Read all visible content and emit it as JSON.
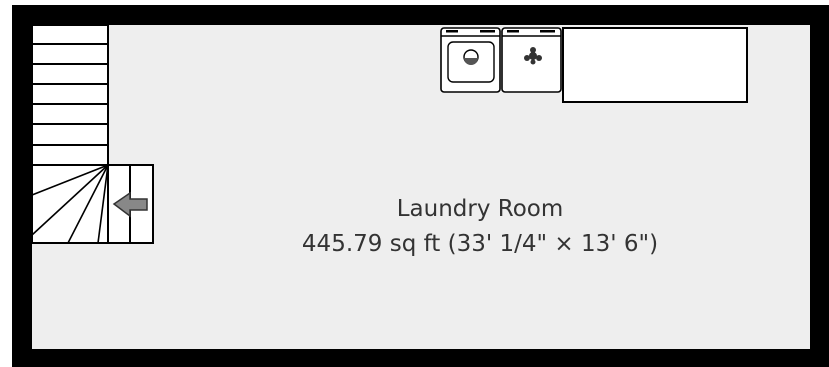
{
  "room": {
    "name": "Laundry Room",
    "area": "445.79 sq ft (33' 1/4\" × 13' 6\")"
  },
  "colors": {
    "wall": "#000000",
    "floor": "#eeeeee",
    "fixture_fill": "#ffffff",
    "fixture_stroke": "#000000",
    "arrow": "#888888",
    "label": "#333333"
  },
  "fixtures": [
    {
      "name": "washer",
      "icon": "washer-icon"
    },
    {
      "name": "dryer",
      "icon": "dryer-icon"
    },
    {
      "name": "counter",
      "icon": "counter-rect"
    }
  ],
  "stairs": {
    "direction": "left",
    "icon": "stair-arrow-icon"
  }
}
